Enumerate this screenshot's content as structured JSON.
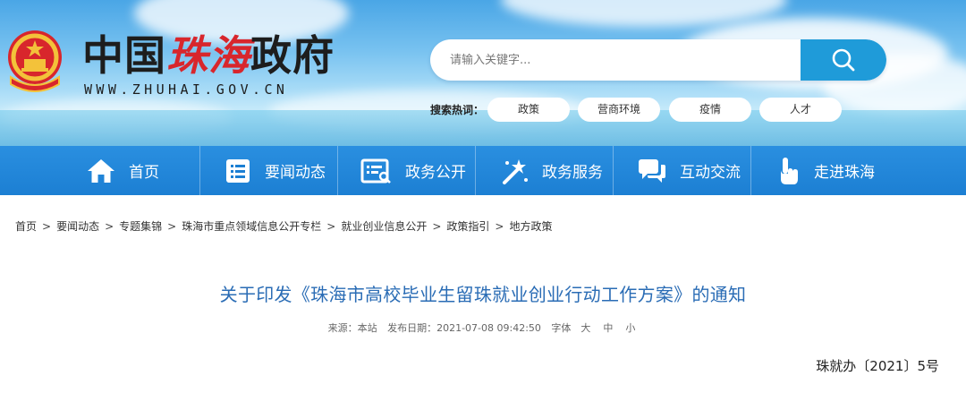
{
  "header": {
    "title_part1": "中国",
    "title_part2": "珠海",
    "title_part3": "政府",
    "domain": "WWW.ZHUHAI.GOV.CN",
    "search": {
      "placeholder": "请输入关键字..."
    },
    "hot_label": "搜索热词：",
    "hot_tags": [
      "政策",
      "营商环境",
      "疫情",
      "人才"
    ]
  },
  "nav": {
    "items": [
      {
        "label": "首页",
        "icon": "home-icon"
      },
      {
        "label": "要闻动态",
        "icon": "news-list-icon"
      },
      {
        "label": "政务公开",
        "icon": "disclosure-icon"
      },
      {
        "label": "政务服务",
        "icon": "service-wand-icon"
      },
      {
        "label": "互动交流",
        "icon": "chat-icon"
      },
      {
        "label": "走进珠海",
        "icon": "pointer-hand-icon"
      }
    ]
  },
  "breadcrumb": [
    "首页",
    "要闻动态",
    "专题集锦",
    "珠海市重点领域信息公开专栏",
    "就业创业信息公开",
    "政策指引",
    "地方政策"
  ],
  "article": {
    "title": "关于印发《珠海市高校毕业生留珠就业创业行动工作方案》的通知",
    "source": "来源：本站",
    "publish": "发布日期：2021-07-08 09:42:50",
    "font_label": "字体",
    "font_sizes": [
      "大",
      "中",
      "小"
    ],
    "doc_number": "珠就办〔2021〕5号"
  },
  "colors": {
    "nav_bg": "#1c7fd3",
    "search_button": "#1f9bd9",
    "title": "#2a6cb5",
    "accent_red": "#d8262c"
  }
}
